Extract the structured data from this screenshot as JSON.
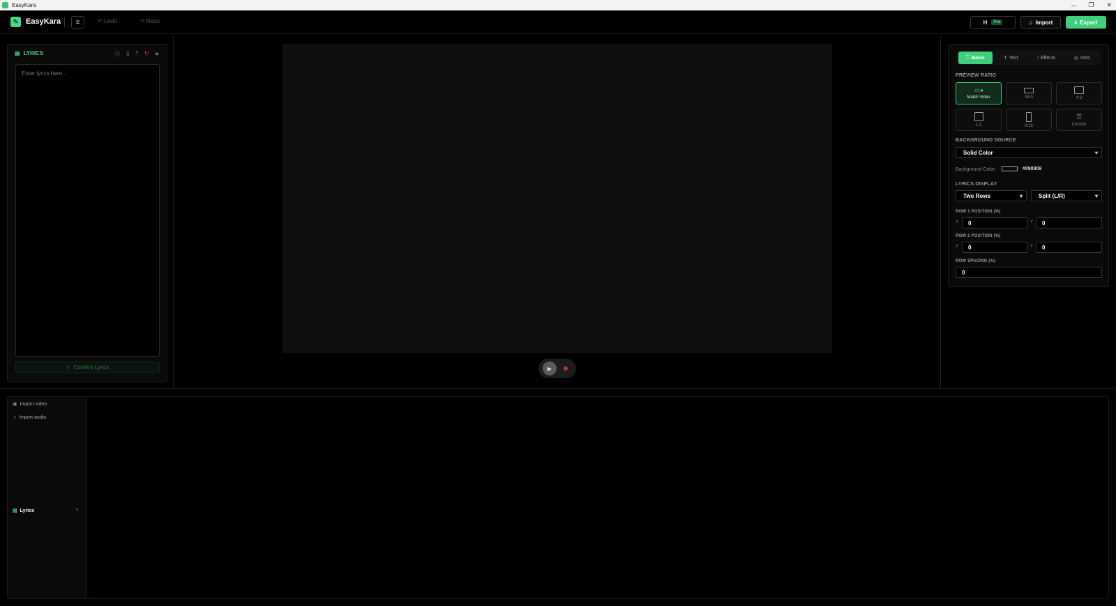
{
  "window": {
    "title": "EasyKara",
    "min": "─",
    "restore": "❐",
    "close": "✕"
  },
  "topbar": {
    "brand": "EasyKara",
    "undo": "↶ Undo",
    "redo": "↷ Redo",
    "hotkey": "H",
    "pro_badge": "Pro",
    "import_label": "Import",
    "export_label": "Export"
  },
  "lyrics": {
    "title": "LYRICS",
    "placeholder": "Enter lyrics here...",
    "confirm_label": "Confirm Lyrics"
  },
  "settings": {
    "tabs": [
      {
        "label": "Basic",
        "active": true
      },
      {
        "label": "Text",
        "active": false
      },
      {
        "label": "Effects",
        "active": false
      },
      {
        "label": "Intro",
        "active": false
      }
    ],
    "preview_ratio_title": "PREVIEW RATIO",
    "ratios": [
      {
        "label": "Match Video",
        "active": true
      },
      {
        "label": "16:9",
        "active": false
      },
      {
        "label": "4:3",
        "active": false
      },
      {
        "label": "1:1",
        "active": false
      },
      {
        "label": "9:16",
        "active": false
      },
      {
        "label": "Custom",
        "active": false
      }
    ],
    "bg_source_title": "BACKGROUND SOURCE",
    "bg_source_value": "Solid Color",
    "bg_color_label": "Background Color:",
    "bg_color_value": "#090909",
    "lyrics_display_title": "LYRICS DISPLAY",
    "display_rows": "Two Rows",
    "display_split": "Split (L/R)",
    "row1_title": "ROW 1 POSITION (%)",
    "row1_x": "0",
    "row1_y": "0",
    "row2_title": "ROW 2 POSITION (%)",
    "row2_x": "0",
    "row2_y": "0",
    "spacing_title": "ROW SPACING (%)",
    "spacing_value": "0",
    "x_label": "X",
    "y_label": "Y"
  },
  "timeline": {
    "tracks": [
      "Import video",
      "Import audio",
      "Lyrics"
    ]
  },
  "colors": {
    "accent": "#3fce7d",
    "background": "#000000",
    "preview": "#0e0e0e"
  }
}
